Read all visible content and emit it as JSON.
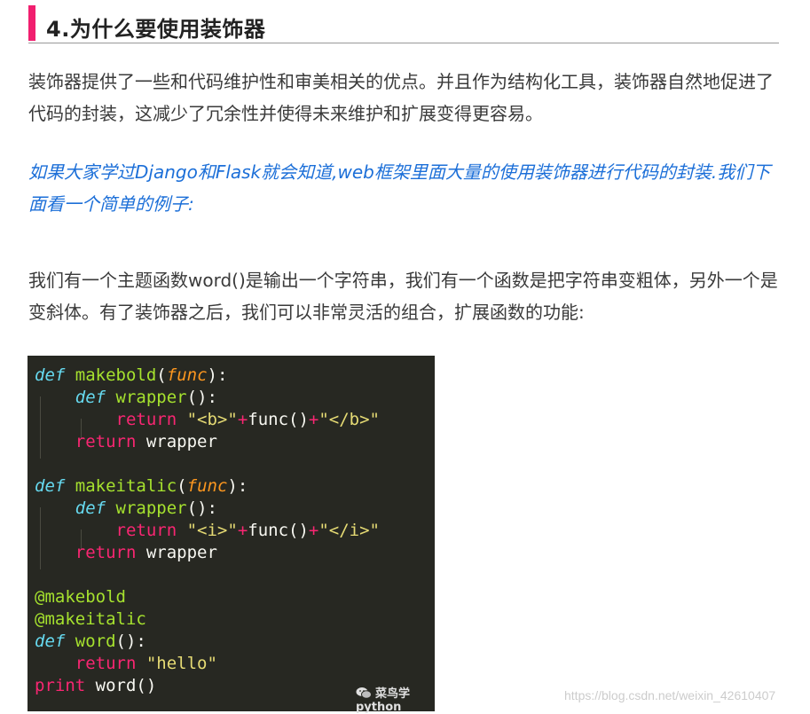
{
  "heading": {
    "title": "4.为什么要使用装饰器"
  },
  "paragraphs": {
    "p1": "装饰器提供了一些和代码维护性和审美相关的优点。并且作为结构化工具，装饰器自然地促进了代码的封装，这减少了冗余性并使得未来维护和扩展变得更容易。",
    "p2": "如果大家学过Django和Flask就会知道,web框架里面大量的使用装饰器进行代码的封装.我们下面看一个简单的例子:",
    "p3": "我们有一个主题函数word()是输出一个字符串，我们有一个函数是把字符串变粗体，另外一个是变斜体。有了装饰器之后，我们可以非常灵活的组合，扩展函数的功能:"
  },
  "code": {
    "lines": [
      {
        "indent": "",
        "tokens": [
          [
            "kw-def",
            "def"
          ],
          [
            "",
            " "
          ],
          [
            "fn",
            "makebold"
          ],
          [
            "",
            "("
          ],
          [
            "param",
            "func"
          ],
          [
            "",
            "):"
          ]
        ]
      },
      {
        "indent": "    ",
        "tokens": [
          [
            "kw-def",
            "def"
          ],
          [
            "",
            " "
          ],
          [
            "fn",
            "wrapper"
          ],
          [
            "",
            "():"
          ]
        ]
      },
      {
        "indent": "        ",
        "tokens": [
          [
            "kw-ret",
            "return"
          ],
          [
            "",
            " "
          ],
          [
            "str",
            "\"<b>\""
          ],
          [
            "op",
            "+"
          ],
          [
            "",
            "func()"
          ],
          [
            "op",
            "+"
          ],
          [
            "str",
            "\"</b>\""
          ]
        ]
      },
      {
        "indent": "    ",
        "tokens": [
          [
            "kw-ret",
            "return"
          ],
          [
            "",
            " wrapper"
          ]
        ]
      },
      {
        "indent": "",
        "tokens": []
      },
      {
        "indent": "",
        "tokens": [
          [
            "kw-def",
            "def"
          ],
          [
            "",
            " "
          ],
          [
            "fn",
            "makeitalic"
          ],
          [
            "",
            "("
          ],
          [
            "param",
            "func"
          ],
          [
            "",
            "):"
          ]
        ]
      },
      {
        "indent": "    ",
        "tokens": [
          [
            "kw-def",
            "def"
          ],
          [
            "",
            " "
          ],
          [
            "fn",
            "wrapper"
          ],
          [
            "",
            "():"
          ]
        ]
      },
      {
        "indent": "        ",
        "tokens": [
          [
            "kw-ret",
            "return"
          ],
          [
            "",
            " "
          ],
          [
            "str",
            "\"<i>\""
          ],
          [
            "op",
            "+"
          ],
          [
            "",
            "func()"
          ],
          [
            "op",
            "+"
          ],
          [
            "str",
            "\"</i>\""
          ]
        ]
      },
      {
        "indent": "    ",
        "tokens": [
          [
            "kw-ret",
            "return"
          ],
          [
            "",
            " wrapper"
          ]
        ]
      },
      {
        "indent": "",
        "tokens": []
      },
      {
        "indent": "",
        "tokens": [
          [
            "deco",
            "@makebold"
          ]
        ]
      },
      {
        "indent": "",
        "tokens": [
          [
            "deco",
            "@makeitalic"
          ]
        ]
      },
      {
        "indent": "",
        "tokens": [
          [
            "kw-def",
            "def"
          ],
          [
            "",
            " "
          ],
          [
            "fn",
            "word"
          ],
          [
            "",
            "():"
          ]
        ]
      },
      {
        "indent": "    ",
        "tokens": [
          [
            "kw-ret",
            "return"
          ],
          [
            "",
            " "
          ],
          [
            "str",
            "\"hello\""
          ]
        ]
      },
      {
        "indent": "",
        "tokens": [
          [
            "kw-ret",
            "print"
          ],
          [
            "",
            " word()"
          ]
        ]
      }
    ]
  },
  "watermark": {
    "label": "菜鸟学python",
    "icon": "wechat-icon"
  },
  "url_watermark": "https://blog.csdn.net/weixin_42610407",
  "colors": {
    "accent_bar": "#f11f6f",
    "italic_blue": "#1c6fd8",
    "code_bg": "#272822"
  }
}
